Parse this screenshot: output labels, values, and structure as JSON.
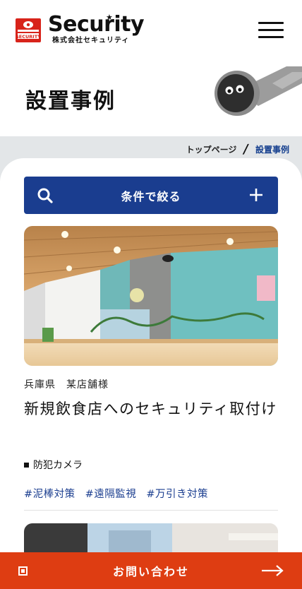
{
  "header": {
    "logo_badge_text": "SECURITY",
    "logo_word": "Security",
    "logo_sub": "株式会社セキュリティ"
  },
  "page": {
    "title": "設置事例"
  },
  "breadcrumb": {
    "home": "トップページ",
    "separator": "/",
    "current": "設置事例"
  },
  "filter": {
    "label": "条件で絞る",
    "search_icon": "search-icon",
    "plus_icon": "plus-icon"
  },
  "case": {
    "location": "兵庫県　某店舗様",
    "title": "新規飲食店へのセキュリティ取付け",
    "category": "防犯カメラ",
    "tags": [
      "#泥棒対策",
      "#遠隔監視",
      "#万引き対策"
    ]
  },
  "cta": {
    "label": "お問い合わせ",
    "icon": "square-icon",
    "arrow_icon": "arrow-right-icon"
  },
  "colors": {
    "brand_blue": "#1a3d8f",
    "cta_orange": "#de3d12",
    "gray_bg": "#e3e6e8"
  }
}
